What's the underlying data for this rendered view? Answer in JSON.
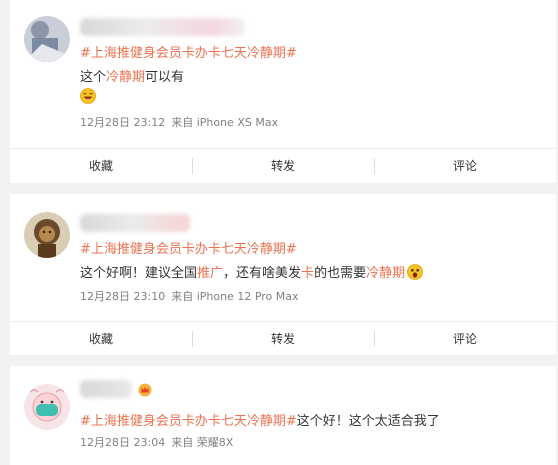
{
  "posts": [
    {
      "hashtag": "#上海推健身会员卡办卡七天冷静期#",
      "text_pre": "这个",
      "text_hl": "冷静期",
      "text_post": "可以有",
      "emoji": "laughing-emoji",
      "date": "12月28日 23:12",
      "source": "来自 iPhone XS Max"
    },
    {
      "hashtag": "#上海推健身会员卡办卡七天冷静期#",
      "text_1": "这个好啊！建议全国",
      "text_hl1": "推广",
      "text_2": "，还有啥美发",
      "text_hl2": "卡",
      "text_3": "的也需要",
      "text_hl3": "冷静期",
      "emoji": "shocked-emoji",
      "date": "12月28日 23:10",
      "source": "来自 iPhone 12 Pro Max"
    },
    {
      "hashtag": "#上海推健身会员卡办卡七天冷静期#",
      "text": "这个好！这个太适合我了",
      "badge": "crown-icon",
      "date": "12月28日 23:04",
      "source": "来自 荣耀8X"
    }
  ],
  "actions": {
    "collect": "收藏",
    "repost": "转发",
    "comment": "评论"
  },
  "colors": {
    "link": "#eb7350",
    "meta": "#808080",
    "background": "#f2f2f2"
  }
}
